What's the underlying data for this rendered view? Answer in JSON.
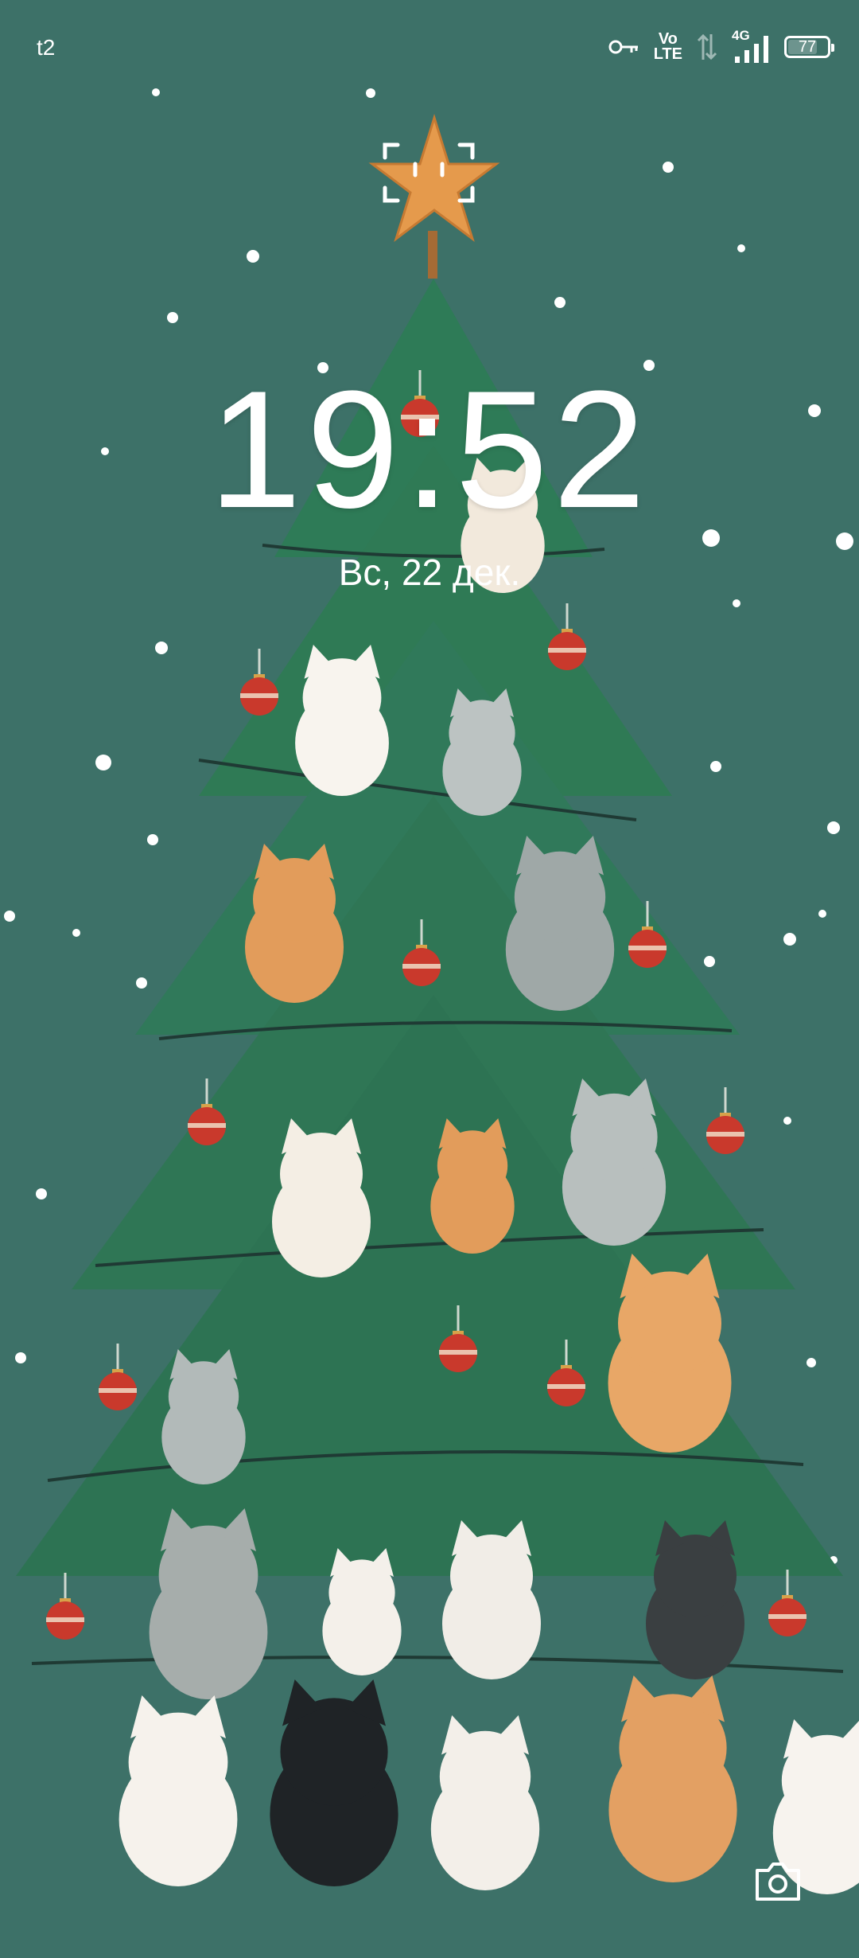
{
  "status_bar": {
    "carrier": "t2",
    "volte_top": "Vo",
    "volte_bottom": "LTE",
    "network": "4G",
    "battery_level": 77,
    "battery_text": "77"
  },
  "lock_screen": {
    "time": "19:52",
    "date": "Вс, 22 дек."
  },
  "icons": {
    "vpn_key": "key-icon",
    "face_unlock": "face-unlock-icon",
    "camera": "camera-icon"
  },
  "wallpaper": {
    "description_colors": {
      "background": "#3d7168",
      "tree": "#2f7a55",
      "star": "#e59a4c",
      "ornament": "#c9392c"
    }
  }
}
